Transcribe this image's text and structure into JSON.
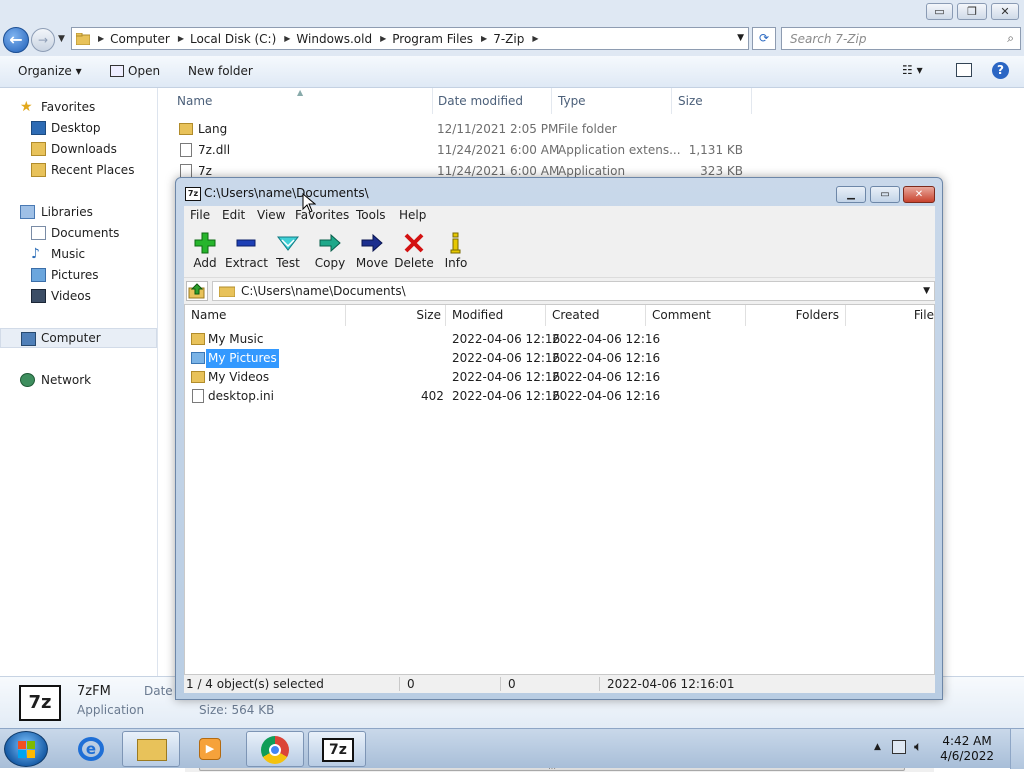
{
  "explorer": {
    "breadcrumbs": [
      "Computer",
      "Local Disk (C:)",
      "Windows.old",
      "Program Files",
      "7-Zip"
    ],
    "search_placeholder": "Search 7-Zip",
    "toolbar": {
      "organize": "Organize",
      "open": "Open",
      "new_folder": "New folder"
    },
    "nav": {
      "favorites": "Favorites",
      "desktop": "Desktop",
      "downloads": "Downloads",
      "recent_places": "Recent Places",
      "libraries": "Libraries",
      "documents": "Documents",
      "music": "Music",
      "pictures": "Pictures",
      "videos": "Videos",
      "computer": "Computer",
      "network": "Network"
    },
    "columns": {
      "name": "Name",
      "date_modified": "Date modified",
      "type": "Type",
      "size": "Size"
    },
    "files": [
      {
        "name": "Lang",
        "date": "12/11/2021 2:05 PM",
        "type": "File folder",
        "size": ""
      },
      {
        "name": "7z.dll",
        "date": "11/24/2021 6:00 AM",
        "type": "Application extens...",
        "size": "1,131 KB"
      },
      {
        "name": "7z",
        "date": "11/24/2021 6:00 AM",
        "type": "Application",
        "size": "323 KB"
      }
    ],
    "details": {
      "name": "7zFM",
      "type": "Application",
      "date_label": "Date m",
      "size": "Size: 564 KB",
      "icon_text": "7z"
    }
  },
  "sevenzip": {
    "title": "C:\\Users\\name\\Documents\\",
    "icon_text": "7z",
    "menu": [
      "File",
      "Edit",
      "View",
      "Favorites",
      "Tools",
      "Help"
    ],
    "tools": [
      "Add",
      "Extract",
      "Test",
      "Copy",
      "Move",
      "Delete",
      "Info"
    ],
    "path": "C:\\Users\\name\\Documents\\",
    "columns": {
      "name": "Name",
      "size": "Size",
      "modified": "Modified",
      "created": "Created",
      "comment": "Comment",
      "folders": "Folders",
      "files": "File"
    },
    "rows": [
      {
        "name": "My Music",
        "size": "",
        "modified": "2022-04-06 12:16",
        "created": "2022-04-06 12:16"
      },
      {
        "name": "My Pictures",
        "size": "",
        "modified": "2022-04-06 12:16",
        "created": "2022-04-06 12:16"
      },
      {
        "name": "My Videos",
        "size": "",
        "modified": "2022-04-06 12:16",
        "created": "2022-04-06 12:16"
      },
      {
        "name": "desktop.ini",
        "size": "402",
        "modified": "2022-04-06 12:16",
        "created": "2022-04-06 12:16"
      }
    ],
    "status": {
      "selected": "1 / 4 object(s) selected",
      "size": "0",
      "packed": "0",
      "datetime": "2022-04-06 12:16:01"
    }
  },
  "taskbar": {
    "time": "4:42 AM",
    "date": "4/6/2022",
    "app_7z": "7z"
  },
  "colors": {
    "selection": "#3399ff",
    "window_frame": "#c9d8ea",
    "taskbar": "#b8cce4"
  }
}
